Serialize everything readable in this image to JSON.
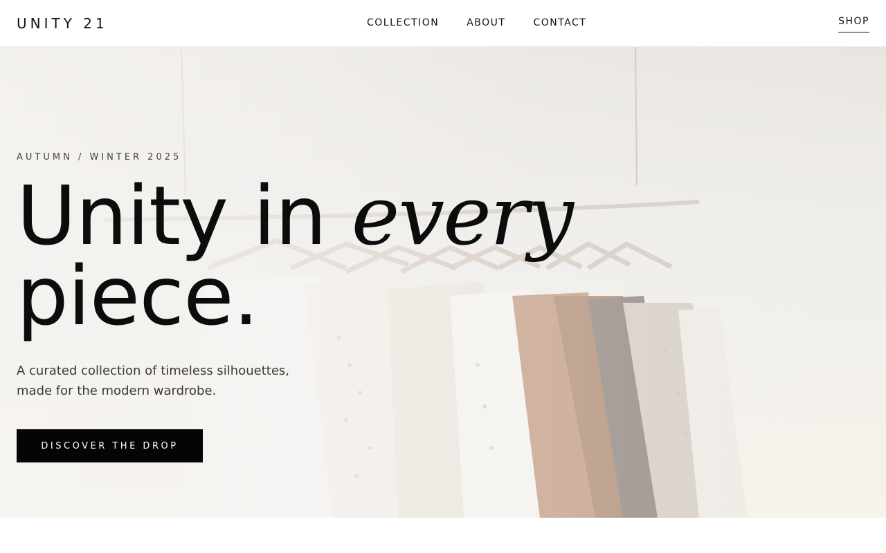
{
  "header": {
    "brand": "UNITY 21",
    "nav": [
      {
        "label": "COLLECTION"
      },
      {
        "label": "ABOUT"
      },
      {
        "label": "CONTACT"
      }
    ],
    "shop_label": "SHOP"
  },
  "hero": {
    "eyebrow": "AUTUMN / WINTER 2025",
    "headline_part1": "Unity in ",
    "headline_emphasis": "every",
    "headline_part2": "piece.",
    "lede_line1": "A curated collection of timeless silhouettes,",
    "lede_line2": "made for the modern wardrobe.",
    "cta_label": "DISCOVER THE DROP",
    "background_image": "clothing-rack-photo"
  },
  "colors": {
    "text": "#0c0c0c",
    "cta_bg": "#050505",
    "cta_text": "#ffffff",
    "page_bg": "#ffffff"
  }
}
